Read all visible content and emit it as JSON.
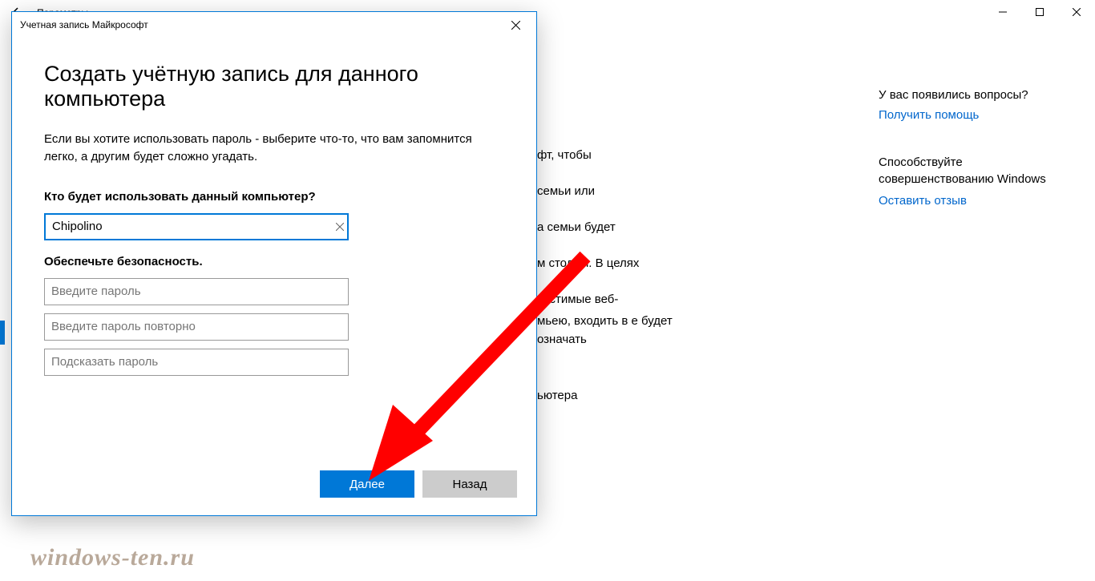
{
  "bg": {
    "back_title": "Параметры",
    "text_fragments": [
      "фт, чтобы",
      "семьи или",
      "а семьи будет",
      "м столом. В целях",
      "пустимые веб-"
    ],
    "block2": [
      "мьею, входить в",
      "е будет означать"
    ],
    "block3": "ьютера",
    "sidebar": {
      "questions": "У вас появились вопросы?",
      "help_link": "Получить помощь",
      "improve": "Способствуйте совершенствованию Windows",
      "feedback_link": "Оставить отзыв"
    }
  },
  "dialog": {
    "title": "Учетная запись Майкрософт",
    "heading": "Создать учётную запись для данного компьютера",
    "intro": "Если вы хотите использовать пароль - выберите что-то, что вам запомнится легко, а другим будет сложно угадать.",
    "who_label": "Кто будет использовать данный компьютер?",
    "username_value": "Chipolino",
    "security_label": "Обеспечьте безопасность.",
    "password_placeholder": "Введите пароль",
    "password2_placeholder": "Введите пароль повторно",
    "hint_placeholder": "Подсказать пароль",
    "next": "Далее",
    "back": "Назад"
  },
  "watermark": "windows-ten.ru"
}
